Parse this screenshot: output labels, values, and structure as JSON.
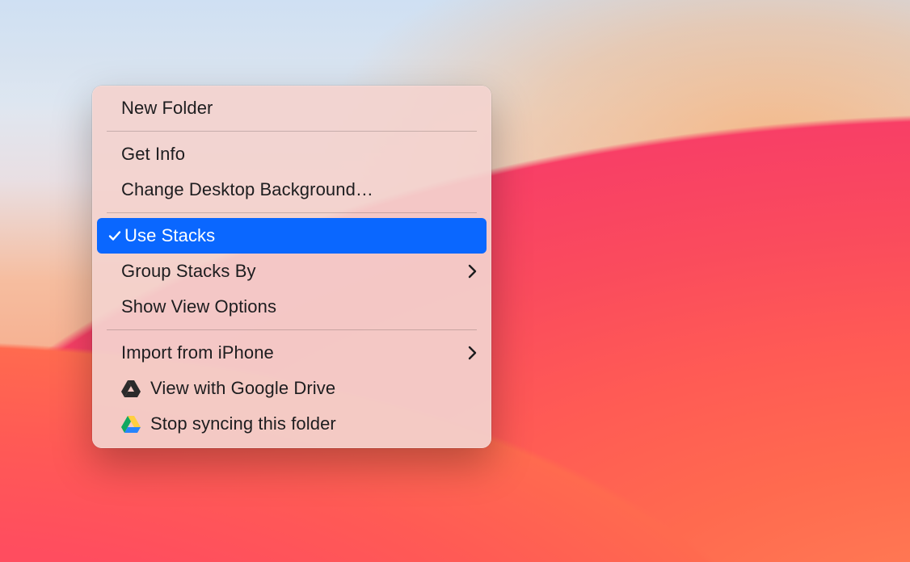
{
  "menu": {
    "groups": [
      [
        {
          "id": "new-folder",
          "label": "New Folder",
          "checked": false,
          "submenu": false,
          "icon": null,
          "highlight": false
        }
      ],
      [
        {
          "id": "get-info",
          "label": "Get Info",
          "checked": false,
          "submenu": false,
          "icon": null,
          "highlight": false
        },
        {
          "id": "change-desktop-background",
          "label": "Change Desktop Background…",
          "checked": false,
          "submenu": false,
          "icon": null,
          "highlight": false
        }
      ],
      [
        {
          "id": "use-stacks",
          "label": "Use Stacks",
          "checked": true,
          "submenu": false,
          "icon": null,
          "highlight": true
        },
        {
          "id": "group-stacks-by",
          "label": "Group Stacks By",
          "checked": false,
          "submenu": true,
          "icon": null,
          "highlight": false
        },
        {
          "id": "show-view-options",
          "label": "Show View Options",
          "checked": false,
          "submenu": false,
          "icon": null,
          "highlight": false
        }
      ],
      [
        {
          "id": "import-from-iphone",
          "label": "Import from iPhone",
          "checked": false,
          "submenu": true,
          "icon": null,
          "highlight": false
        },
        {
          "id": "view-with-google-drive",
          "label": "View with Google Drive",
          "checked": false,
          "submenu": false,
          "icon": "gdrive-dark",
          "highlight": false
        },
        {
          "id": "stop-syncing-this-folder",
          "label": "Stop syncing this folder",
          "checked": false,
          "submenu": false,
          "icon": "gdrive-color",
          "highlight": false
        }
      ]
    ]
  }
}
